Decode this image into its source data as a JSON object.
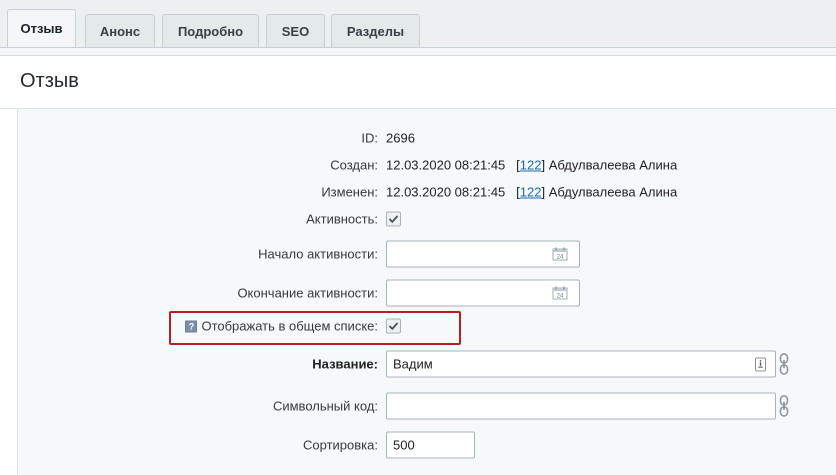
{
  "tabs": [
    {
      "label": "Отзыв",
      "active": true
    },
    {
      "label": "Анонс",
      "active": false
    },
    {
      "label": "Подробно",
      "active": false
    },
    {
      "label": "SEO",
      "active": false
    },
    {
      "label": "Разделы",
      "active": false
    }
  ],
  "panel": {
    "title": "Отзыв"
  },
  "fields": {
    "id": {
      "label": "ID:",
      "value": "2696"
    },
    "created": {
      "label": "Создан:",
      "date": "12.03.2020 08:21:45",
      "bracket_open": "[",
      "user_id": "122",
      "bracket_close": "]",
      "user_name": "Абдулвалеева Алина"
    },
    "modified": {
      "label": "Изменен:",
      "date": "12.03.2020 08:21:45",
      "bracket_open": "[",
      "user_id": "122",
      "bracket_close": "]",
      "user_name": "Абдулвалеева Алина"
    },
    "active": {
      "label": "Активность:",
      "checked": true
    },
    "active_from": {
      "label": "Начало активности:",
      "value": ""
    },
    "active_to": {
      "label": "Окончание активности:",
      "value": ""
    },
    "show_in_list": {
      "label": "Отображать в общем списке:",
      "help": "?",
      "checked": true
    },
    "name": {
      "label": "Название:",
      "value": "Вадим"
    },
    "code": {
      "label": "Символьный код:",
      "value": ""
    },
    "sort": {
      "label": "Сортировка:",
      "value": "500"
    }
  },
  "icons": {
    "calendar": "calendar-icon",
    "translit": "translit-icon",
    "chain": "link-chain-icon",
    "help": "help-icon",
    "check": "checkmark-icon"
  },
  "colors": {
    "highlight": "#b42020",
    "link": "#2067b0"
  }
}
